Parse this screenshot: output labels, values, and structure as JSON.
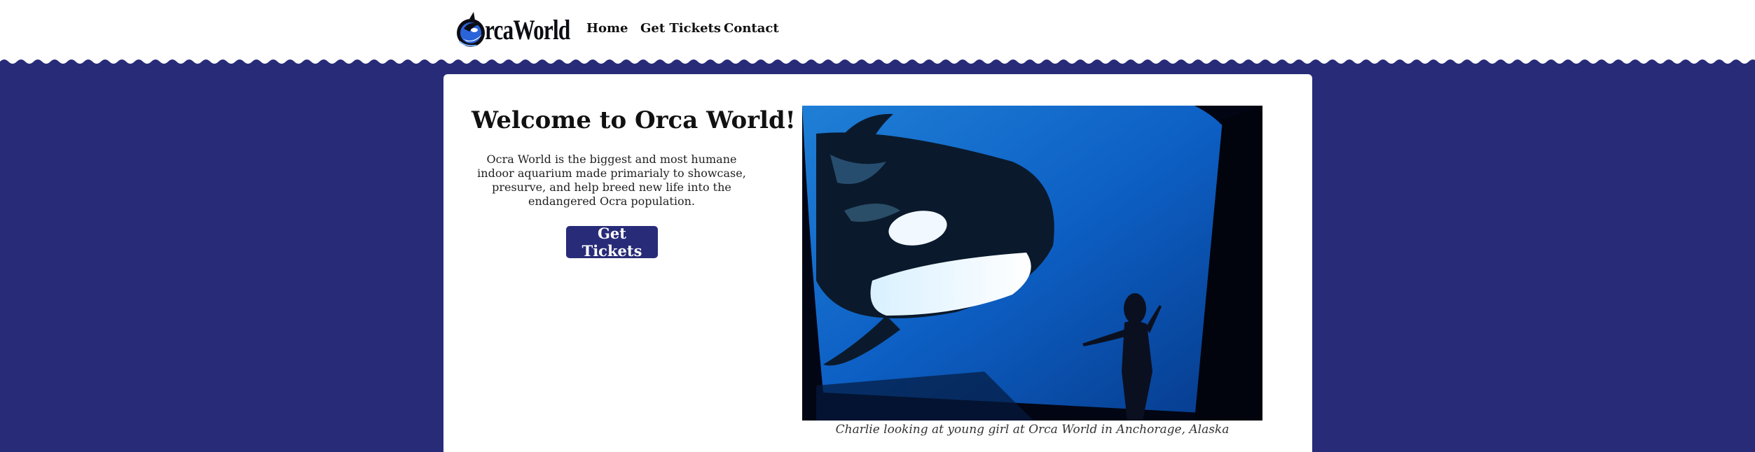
{
  "nav": {
    "logo_text": "rcaWorld",
    "links": [
      {
        "label": "Home"
      },
      {
        "label": "Get Tickets"
      },
      {
        "label": "Contact"
      }
    ]
  },
  "hero": {
    "title": "Welcome to Orca World!",
    "intro": "Ocra World is the biggest and most humane indoor aquarium made primarialy to showcase, presurve, and help breed new life into the endangered Ocra population.",
    "cta_label": "Get Tickets",
    "image_caption": "Charlie looking at young girl at Orca World in Anchorage, Alaska"
  },
  "colors": {
    "brand_navy": "#282b78",
    "background": "#ffffff",
    "card": "#ffffff"
  },
  "icons": {
    "logo": "orca-logo-icon"
  }
}
